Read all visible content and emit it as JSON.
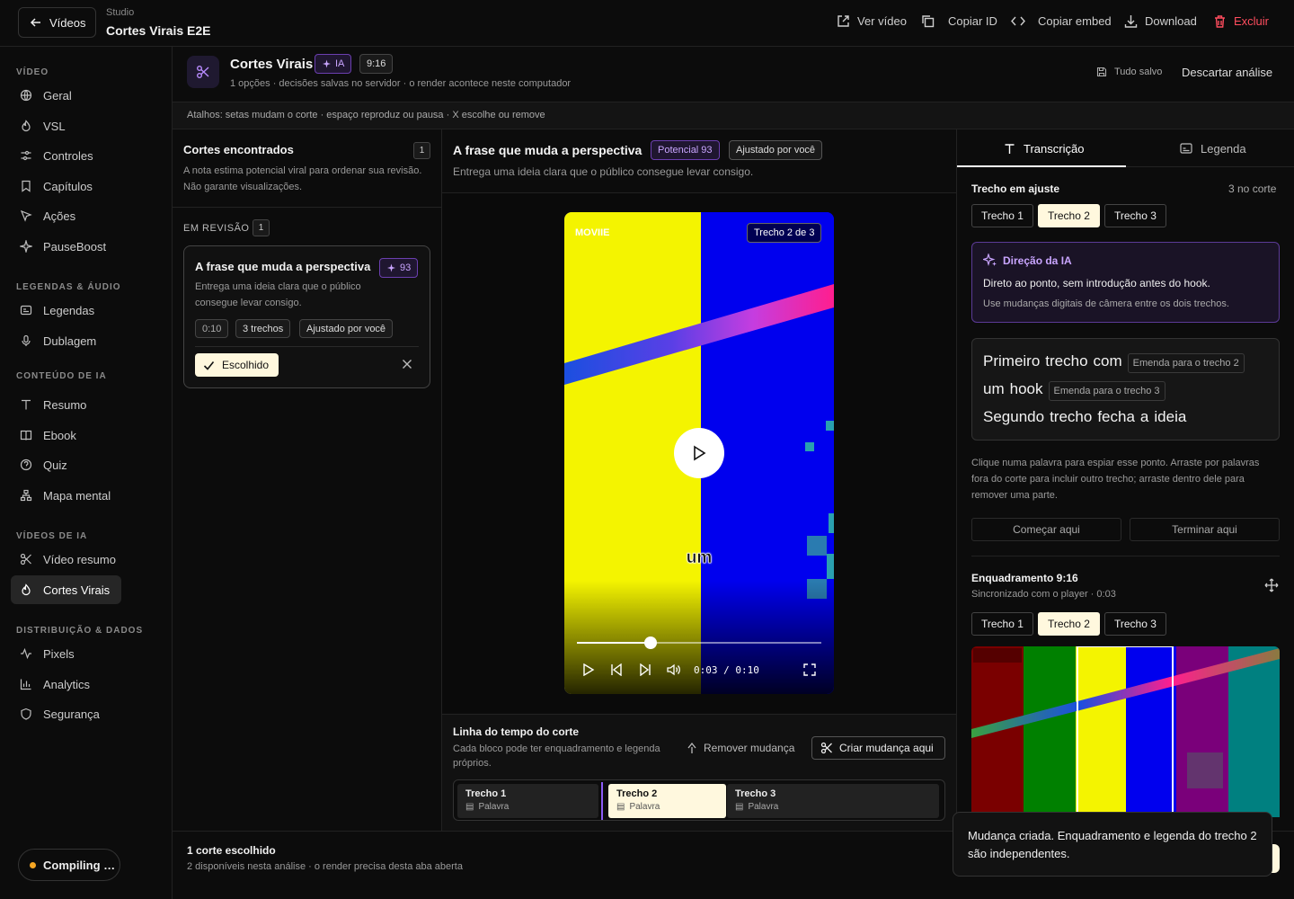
{
  "topbar": {
    "back_label": "Vídeos",
    "studio_label": "Studio",
    "title": "Cortes Virais E2E",
    "actions": {
      "ver_video": "Ver vídeo",
      "copiar_id": "Copiar ID",
      "copiar_embed": "Copiar embed",
      "download": "Download",
      "excluir": "Excluir"
    }
  },
  "sidebar": {
    "sections": [
      {
        "title": "VÍDEO",
        "items": [
          {
            "label": "Geral",
            "icon": "globe-icon"
          },
          {
            "label": "VSL",
            "icon": "flame-icon"
          },
          {
            "label": "Controles",
            "icon": "sliders-icon"
          },
          {
            "label": "Capítulos",
            "icon": "bookmark-icon"
          },
          {
            "label": "Ações",
            "icon": "cursor-icon"
          },
          {
            "label": "PauseBoost",
            "icon": "sparkle-icon"
          }
        ]
      },
      {
        "title": "LEGENDAS & ÁUDIO",
        "items": [
          {
            "label": "Legendas",
            "icon": "captions-icon"
          },
          {
            "label": "Dublagem",
            "icon": "mic-icon"
          }
        ]
      },
      {
        "title": "CONTEÚDO DE IA",
        "items": [
          {
            "label": "Resumo",
            "icon": "text-icon"
          },
          {
            "label": "Ebook",
            "icon": "book-icon"
          },
          {
            "label": "Quiz",
            "icon": "help-circle-icon"
          },
          {
            "label": "Mapa mental",
            "icon": "network-icon"
          }
        ]
      },
      {
        "title": "VÍDEOS DE IA",
        "items": [
          {
            "label": "Vídeo resumo",
            "icon": "scissors-icon"
          },
          {
            "label": "Cortes Virais",
            "icon": "flame-icon",
            "active": true
          }
        ]
      },
      {
        "title": "DISTRIBUIÇÃO & DADOS",
        "items": [
          {
            "label": "Pixels",
            "icon": "activity-icon"
          },
          {
            "label": "Analytics",
            "icon": "bar-chart-icon"
          },
          {
            "label": "Segurança",
            "icon": "shield-icon"
          }
        ]
      }
    ],
    "compiling_label": "Compiling …"
  },
  "header": {
    "title": "Cortes Virais",
    "ia_badge": "IA",
    "ratio_badge": "9:16",
    "subtitle": "1 opções · decisões salvas no servidor · o render acontece neste computador",
    "saved": "Tudo salvo",
    "discard": "Descartar análise"
  },
  "shortcuts": "Atalhos: setas mudam o corte · espaço reproduz ou pausa · X escolhe ou remove",
  "cortes": {
    "title": "Cortes encontrados",
    "count": "1",
    "desc": "A nota estima potencial viral para ordenar sua revisão. Não garante visualizações.",
    "review_label": "EM REVISÃO",
    "review_count": "1",
    "card": {
      "title": "A frase que muda a perspectiva",
      "score": "93",
      "desc": "Entrega uma ideia clara que o público consegue levar consigo.",
      "duration": "0:10",
      "trechos": "3 trechos",
      "adjusted": "Ajustado por você",
      "chosen": "Escolhido"
    }
  },
  "main": {
    "title": "A frase que muda a perspectiva",
    "potential": "Potencial 93",
    "adjusted": "Ajustado por você",
    "desc": "Entrega uma ideia clara que o público consegue levar consigo.",
    "player": {
      "watermark": "MOVIIE",
      "segment": "Trecho 2 de 3",
      "caption": "um",
      "time": "0:03 / 0:10",
      "progress": 0.3
    },
    "timeline": {
      "title": "Linha do tempo do corte",
      "desc": "Cada bloco pode ter enquadramento e legenda próprios.",
      "remove": "Remover mudança",
      "create": "Criar mudança aqui",
      "segments": [
        {
          "label": "Trecho 1",
          "sub": "Palavra"
        },
        {
          "label": "Trecho 2",
          "sub": "Palavra",
          "selected": true
        },
        {
          "label": "Trecho 3",
          "sub": "Palavra"
        }
      ]
    }
  },
  "right": {
    "tabs": {
      "transcricao": "Transcrição",
      "legenda": "Legenda"
    },
    "adjust_title": "Trecho em ajuste",
    "adjust_count": "3 no corte",
    "trechos": [
      "Trecho 1",
      "Trecho 2",
      "Trecho 3"
    ],
    "ia": {
      "title": "Direção da IA",
      "line1": "Direto ao ponto, sem introdução antes do hook.",
      "line2": "Use mudanças digitais de câmera entre os dois trechos."
    },
    "words": {
      "w1": "Primeiro",
      "w2": "trecho",
      "w3": "com",
      "e1": "Emenda para o trecho 2",
      "w4": "um",
      "w5": "hook",
      "e2": "Emenda para o trecho 3",
      "w6": "Segundo",
      "w7": "trecho",
      "w8": "fecha",
      "w9": "a",
      "w10": "ideia"
    },
    "help": "Clique numa palavra para espiar esse ponto. Arraste por palavras fora do corte para incluir outro trecho; arraste dentro dele para remover uma parte.",
    "start_here": "Começar aqui",
    "end_here": "Terminar aqui",
    "framing_title": "Enquadramento 9:16",
    "framing_sub": "Sincronizado com o player · 0:03",
    "framing_trechos": [
      "Trecho 1",
      "Trecho 2",
      "Trecho 3"
    ]
  },
  "bottom": {
    "title": "1 corte escolhido",
    "sub": "2 disponíveis nesta análise · o render precisa desta aba aberta"
  },
  "toast": "Mudança criada. Enquadramento e legenda do trecho 2 são independentes."
}
